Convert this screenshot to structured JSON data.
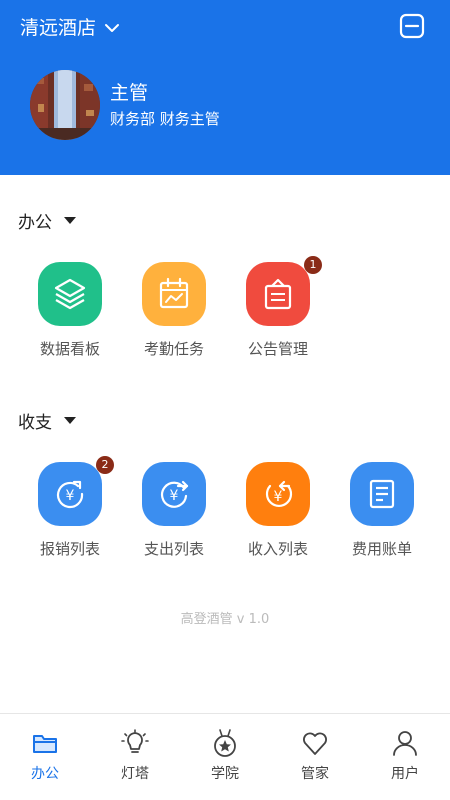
{
  "header": {
    "hotel_name": "清远酒店",
    "user_name": "主管",
    "user_dept": "财务部 财务主管"
  },
  "sections": [
    {
      "title": "办公",
      "items": [
        {
          "label": "数据看板",
          "icon": "layers-icon",
          "color": "#20c08a",
          "badge": ""
        },
        {
          "label": "考勤任务",
          "icon": "calendar-chart-icon",
          "color": "#ffb13d",
          "badge": ""
        },
        {
          "label": "公告管理",
          "icon": "notice-board-icon",
          "color": "#f04b3e",
          "badge": "1"
        }
      ]
    },
    {
      "title": "收支",
      "items": [
        {
          "label": "报销列表",
          "icon": "yuan-return-icon",
          "color": "#3b8ef0",
          "badge": "2"
        },
        {
          "label": "支出列表",
          "icon": "yuan-out-icon",
          "color": "#3b8ef0",
          "badge": ""
        },
        {
          "label": "收入列表",
          "icon": "yuan-in-icon",
          "color": "#ff7f0e",
          "badge": ""
        },
        {
          "label": "费用账单",
          "icon": "bill-icon",
          "color": "#3b8ef0",
          "badge": ""
        }
      ]
    }
  ],
  "version": "高登酒管 v 1.0",
  "tabs": [
    {
      "label": "办公",
      "icon": "folder-icon",
      "active": true
    },
    {
      "label": "灯塔",
      "icon": "lightbulb-icon",
      "active": false
    },
    {
      "label": "学院",
      "icon": "medal-icon",
      "active": false
    },
    {
      "label": "管家",
      "icon": "heart-icon",
      "active": false
    },
    {
      "label": "用户",
      "icon": "user-icon",
      "active": false
    }
  ],
  "colors": {
    "primary": "#1a73e8",
    "badge": "#8a2b17"
  }
}
